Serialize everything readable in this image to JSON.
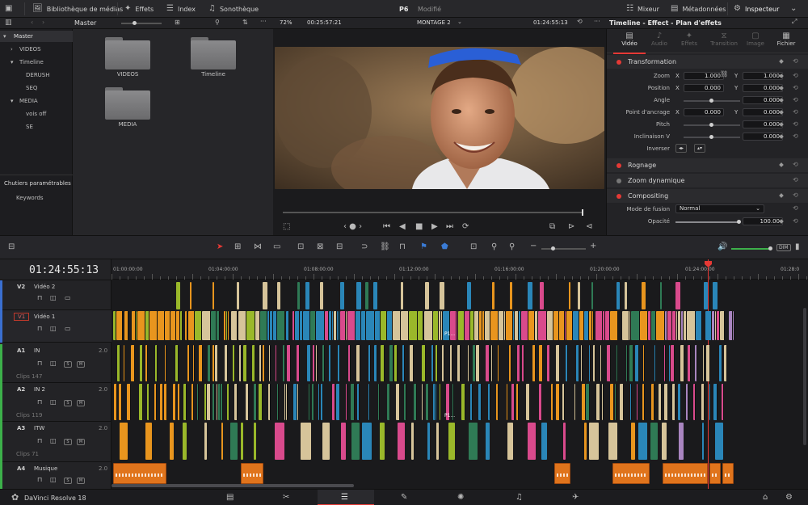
{
  "topbar": {
    "media_library": "Bibliothèque de médias",
    "effects": "Effets",
    "index": "Index",
    "sound_library": "Sonothèque",
    "project": "P6",
    "status": "Modifié",
    "mixer": "Mixeur",
    "metadata": "Métadonnées",
    "inspector": "Inspecteur"
  },
  "pool": {
    "bin_title": "Master",
    "zoom": "72%",
    "source_tc": "00:25:57:21",
    "timeline_name": "MONTAGE 2",
    "record_tc": "01:24:55:13",
    "folders": [
      "VIDEOS",
      "Timeline",
      "MEDIA"
    ]
  },
  "bins": {
    "items": [
      "Master",
      "VIDEOS",
      "Timeline",
      "DERUSH",
      "SEQ",
      "MEDIA",
      "vois off",
      "SE"
    ],
    "smart_bins": "Chutiers paramétrables",
    "keywords": "Keywords"
  },
  "inspector": {
    "title": "Timeline - Effect - Plan d'effets",
    "tabs": [
      "Vidéo",
      "Audio",
      "Effets",
      "Transition",
      "Image",
      "Fichier"
    ],
    "sections": {
      "transformation": "Transformation",
      "cropping": "Rognage",
      "dynamic_zoom": "Zoom dynamique",
      "compositing": "Compositing"
    },
    "labels": {
      "zoom": "Zoom",
      "position": "Position",
      "angle": "Angle",
      "anchor": "Point d'ancrage",
      "pitch": "Pitch",
      "tilt": "Inclinaison V",
      "flip": "Inverser",
      "blend": "Mode de fusion",
      "opacity": "Opacité"
    },
    "values": {
      "zoom_x": "1.000",
      "zoom_y": "1.000",
      "pos_x": "0.000",
      "pos_y": "0.000",
      "angle": "0.000",
      "anchor_x": "0.000",
      "anchor_y": "0.000",
      "pitch": "0.000",
      "tilt": "0.000",
      "blend": "Normal",
      "opacity": "100.00"
    },
    "axes": [
      "X",
      "Y"
    ]
  },
  "timeline": {
    "timecode": "01:24:55:13",
    "ruler": [
      "01:00:00:00",
      "01:04:00:00",
      "01:08:00:00",
      "01:12:00:00",
      "01:16:00:00",
      "01:20:00:00",
      "01:24:00:00",
      "01:28:0"
    ],
    "tracks": [
      {
        "id": "V2",
        "name": "Vidéo 2",
        "clips": ""
      },
      {
        "id": "V1",
        "name": "Vidéo 1",
        "clips": ""
      },
      {
        "id": "A1",
        "name": "IN",
        "level": "2.0",
        "clips": "Clips 147"
      },
      {
        "id": "A2",
        "name": "IN 2",
        "level": "2.0",
        "clips": "Clips 119"
      },
      {
        "id": "A3",
        "name": "ITW",
        "level": "2.0",
        "clips": "Clips 71"
      },
      {
        "id": "A4",
        "name": "Musique",
        "level": "2.0",
        "clips": ""
      }
    ],
    "clip_labels": [
      "P1...",
      "P1..."
    ],
    "solo": "S",
    "mute": "M",
    "dim": "DIM"
  },
  "bottom": {
    "app_name": "DaVinci Resolve 18"
  }
}
